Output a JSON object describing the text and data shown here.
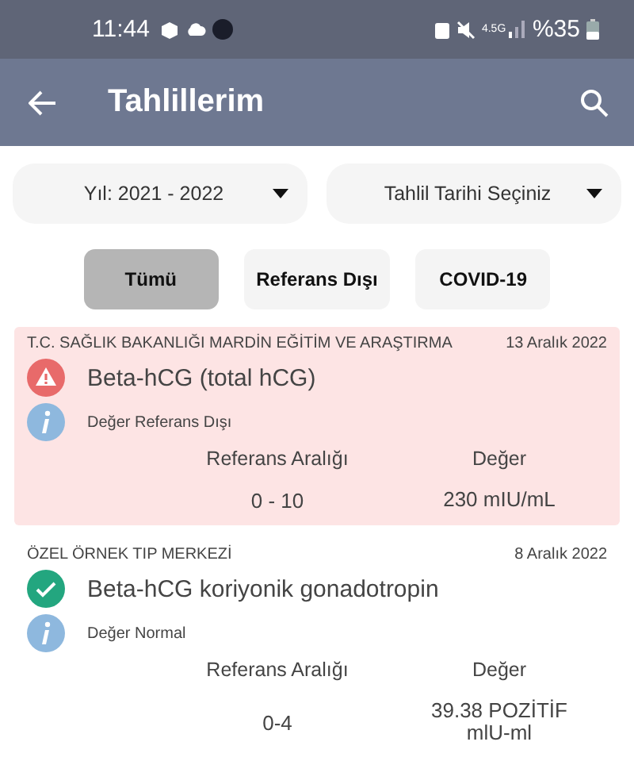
{
  "status_bar": {
    "time": "11:44",
    "network": "4.5G",
    "battery": "%35"
  },
  "app_bar": {
    "title": "Tahlillerim"
  },
  "filters": [
    {
      "label": "Yıl: 2021 - 2022"
    },
    {
      "label": "Tahlil Tarihi Seçiniz"
    }
  ],
  "tabs": [
    {
      "label": "Tümü",
      "selected": true
    },
    {
      "label": "Referans Dışı",
      "selected": false
    },
    {
      "label": "COVID-19",
      "selected": false
    }
  ],
  "results": [
    {
      "institution": "T.C. SAĞLIK BAKANLIĞI MARDİN EĞİTİM VE ARAŞTIRMA",
      "date": "13 Aralık 2022",
      "kind": "abnormal",
      "test": "Beta-hCG (total hCG)",
      "note": "Değer Referans Dışı",
      "range_label": "Referans Aralığı",
      "value_label": "Değer",
      "range": "0 - 10",
      "value": "230 mIU/mL"
    },
    {
      "institution": "ÖZEL ÖRNEK TIP MERKEZİ",
      "date": "8 Aralık 2022",
      "kind": "normal",
      "test": "Beta-hCG koriyonik gonadotropin",
      "note": "Değer Normal",
      "range_label": "Referans Aralığı",
      "value_label": "Değer",
      "range": "0-4",
      "value": "39.38 POZİTİF mlU-ml"
    }
  ]
}
